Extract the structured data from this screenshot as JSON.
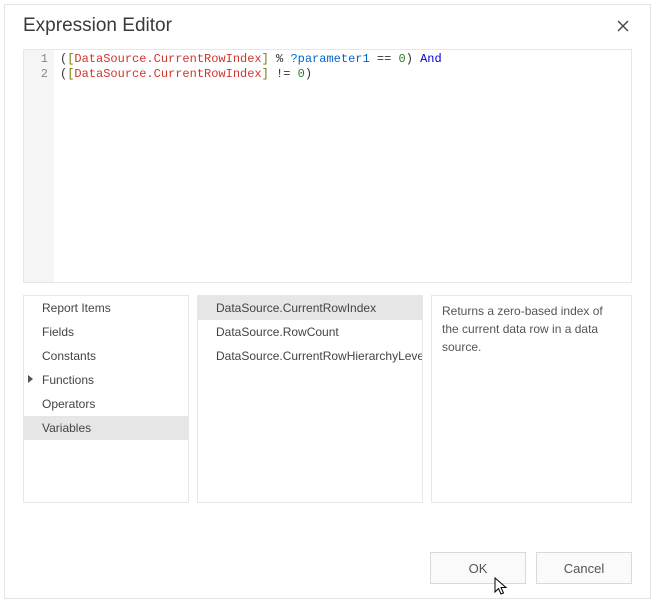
{
  "header": {
    "title": "Expression Editor"
  },
  "code": {
    "lines": [
      {
        "num": "1",
        "tokens": [
          {
            "cls": "tok-punct",
            "t": "("
          },
          {
            "cls": "tok-bracket",
            "t": "["
          },
          {
            "cls": "tok-field",
            "t": "DataSource.CurrentRowIndex"
          },
          {
            "cls": "tok-bracket",
            "t": "]"
          },
          {
            "cls": "tok-punct",
            "t": " % "
          },
          {
            "cls": "tok-param",
            "t": "?parameter1"
          },
          {
            "cls": "tok-punct",
            "t": " == "
          },
          {
            "cls": "tok-num",
            "t": "0"
          },
          {
            "cls": "tok-punct",
            "t": ") "
          },
          {
            "cls": "tok-kw",
            "t": "And"
          }
        ]
      },
      {
        "num": "2",
        "tokens": [
          {
            "cls": "tok-punct",
            "t": "("
          },
          {
            "cls": "tok-bracket",
            "t": "["
          },
          {
            "cls": "tok-field",
            "t": "DataSource.CurrentRowIndex"
          },
          {
            "cls": "tok-bracket",
            "t": "]"
          },
          {
            "cls": "tok-punct",
            "t": " != "
          },
          {
            "cls": "tok-num",
            "t": "0"
          },
          {
            "cls": "tok-punct",
            "t": ")"
          }
        ]
      }
    ]
  },
  "categories": {
    "items": [
      {
        "label": "Report Items",
        "selected": false,
        "expandable": false
      },
      {
        "label": "Fields",
        "selected": false,
        "expandable": false
      },
      {
        "label": "Constants",
        "selected": false,
        "expandable": false
      },
      {
        "label": "Functions",
        "selected": false,
        "expandable": true
      },
      {
        "label": "Operators",
        "selected": false,
        "expandable": false
      },
      {
        "label": "Variables",
        "selected": true,
        "expandable": false
      }
    ]
  },
  "members": {
    "items": [
      {
        "label": "DataSource.CurrentRowIndex",
        "selected": true
      },
      {
        "label": "DataSource.RowCount",
        "selected": false
      },
      {
        "label": "DataSource.CurrentRowHierarchyLevel",
        "selected": false
      }
    ]
  },
  "description": "Returns a zero-based index of the current data row in a data source.",
  "footer": {
    "ok": "OK",
    "cancel": "Cancel"
  }
}
